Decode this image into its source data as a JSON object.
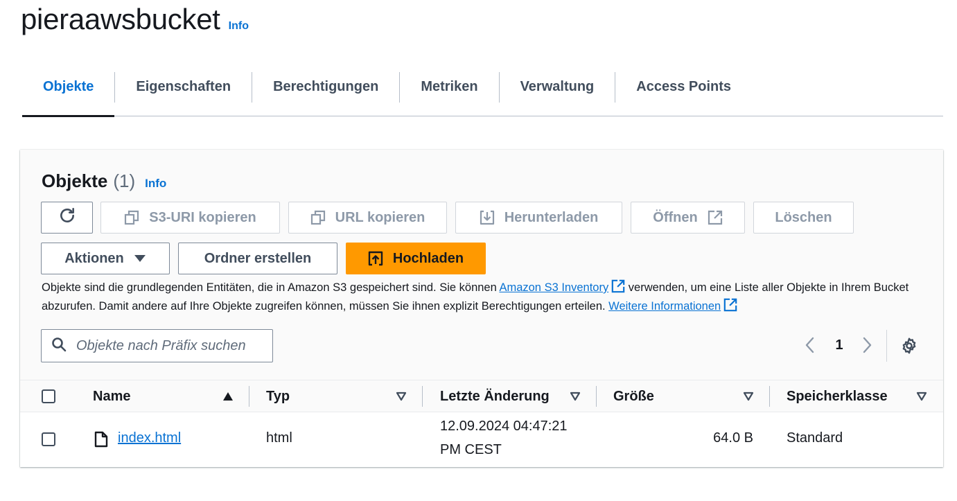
{
  "page": {
    "title": "pieraawsbucket",
    "info_label": "Info"
  },
  "tabs": [
    {
      "label": "Objekte",
      "active": true
    },
    {
      "label": "Eigenschaften"
    },
    {
      "label": "Berechtigungen"
    },
    {
      "label": "Metriken"
    },
    {
      "label": "Verwaltung"
    },
    {
      "label": "Access Points"
    }
  ],
  "objects_panel": {
    "title": "Objekte",
    "count": "(1)",
    "info_label": "Info",
    "toolbar": {
      "refresh_icon": "refresh-icon",
      "copy_s3_uri": "S3-URI kopieren",
      "copy_url": "URL kopieren",
      "download": "Herunterladen",
      "open": "Öffnen",
      "delete": "Löschen",
      "actions": "Aktionen",
      "create_folder": "Ordner erstellen",
      "upload": "Hochladen"
    },
    "description": {
      "part1": "Objekte sind die grundlegenden Entitäten, die in Amazon S3 gespeichert sind. Sie können ",
      "link1": "Amazon S3 Inventory",
      "part2": " verwenden, um eine Liste aller Objekte in Ihrem Bucket abzurufen. Damit andere auf Ihre Objekte zugreifen können, müssen Sie ihnen explizit Berechtigungen erteilen. ",
      "link2": "Weitere Informationen"
    },
    "search": {
      "placeholder": "Objekte nach Präfix suchen",
      "value": ""
    },
    "pagination": {
      "current_page": "1"
    },
    "table": {
      "columns": [
        "Name",
        "Typ",
        "Letzte Änderung",
        "Größe",
        "Speicherklasse"
      ],
      "rows": [
        {
          "name": "index.html",
          "type": "html",
          "modified_line1": "12.09.2024 04:47:21",
          "modified_line2": "PM CEST",
          "size": "64.0 B",
          "storage_class": "Standard",
          "checked": false
        }
      ]
    }
  },
  "colors": {
    "accent": "#0972d3",
    "primary_button": "#ff9900",
    "text": "#16191f",
    "muted_text": "#414d5c"
  }
}
